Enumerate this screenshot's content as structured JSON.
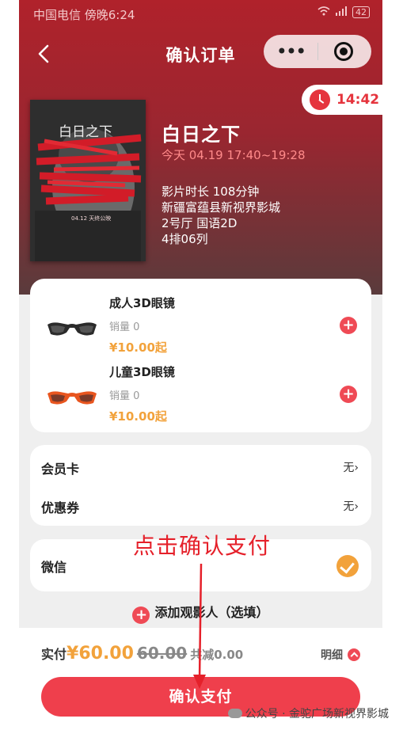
{
  "status_bar": {
    "carrier_time": "中国电信 傍晚6:24",
    "battery": "42"
  },
  "nav": {
    "title": "确认订单"
  },
  "timer": {
    "value": "14:42"
  },
  "movie": {
    "name": "白日之下",
    "showtime": "今天 04.19 17:40~19:28",
    "duration": "影片时长  108分钟",
    "cinema": "新疆富蕴县新视界影城",
    "hall": "2号厅  国语2D",
    "seat": "4排06列"
  },
  "poster": {
    "title": "白日之下",
    "date_text": "04.12 天终公映"
  },
  "addons": [
    {
      "name": "成人3D眼镜",
      "sales": "销量 0",
      "price": "¥10.00起"
    },
    {
      "name": "儿童3D眼镜",
      "sales": "销量 0",
      "price": "¥10.00起"
    }
  ],
  "discounts": {
    "member_label": "会员卡",
    "member_value": "无",
    "coupon_label": "优惠券",
    "coupon_value": "无"
  },
  "payment": {
    "method": "微信"
  },
  "add_viewer": "添加观影人（选填）",
  "footer": {
    "paid_label": "实付",
    "amount": "¥60.00",
    "original": "60.00",
    "discount": "共减0.00",
    "detail_label": "明细",
    "pay_button": "确认支付"
  },
  "annotation": "点击确认支付",
  "watermark": "公众号 · 金驼广场新视界影城",
  "colors": {
    "accent": "#ef3f4c",
    "price": "#f2a23b",
    "hero": "#b0222b"
  }
}
